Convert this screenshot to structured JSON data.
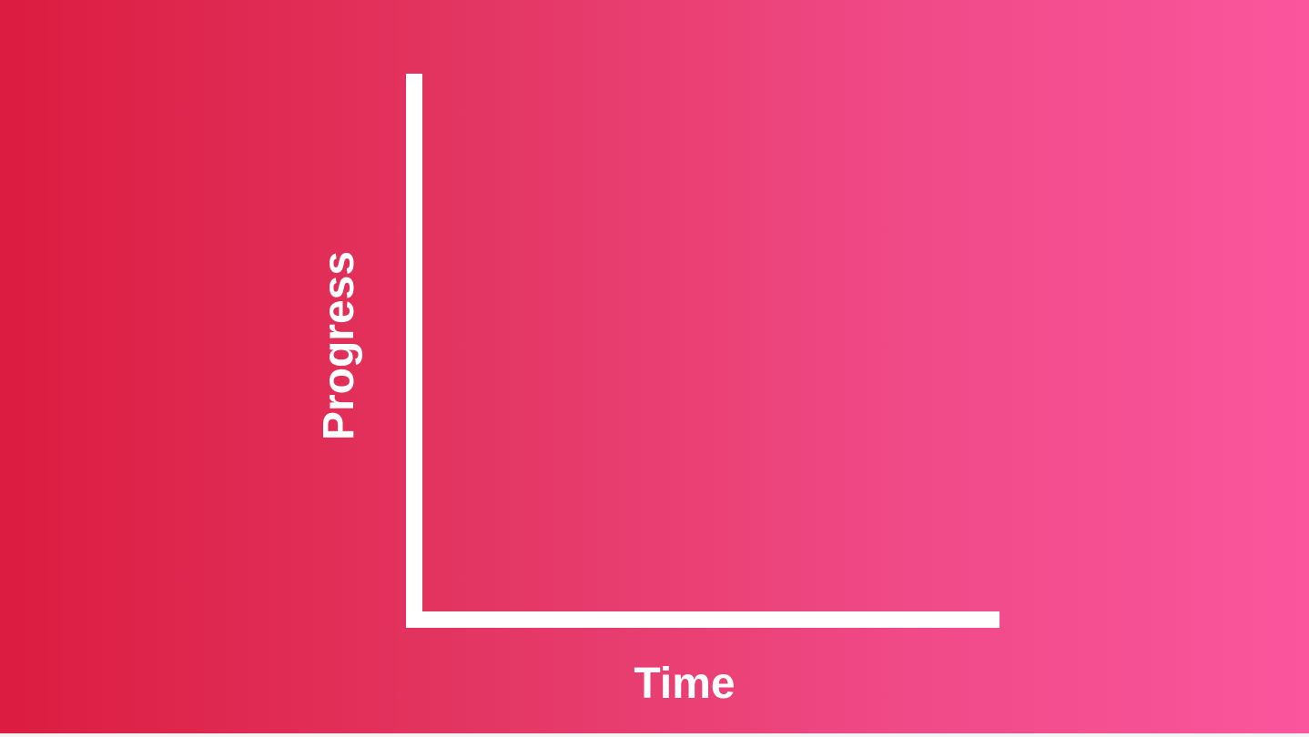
{
  "theme": {
    "gradient_start": "#dc1c40",
    "gradient_end": "#fb559e",
    "axis_color": "#ffffff",
    "label_color": "#ffffff"
  },
  "chart_data": {
    "type": "line",
    "title": "",
    "xlabel": "Time",
    "ylabel": "Progress",
    "series": [],
    "grid": false,
    "legend": "none"
  }
}
